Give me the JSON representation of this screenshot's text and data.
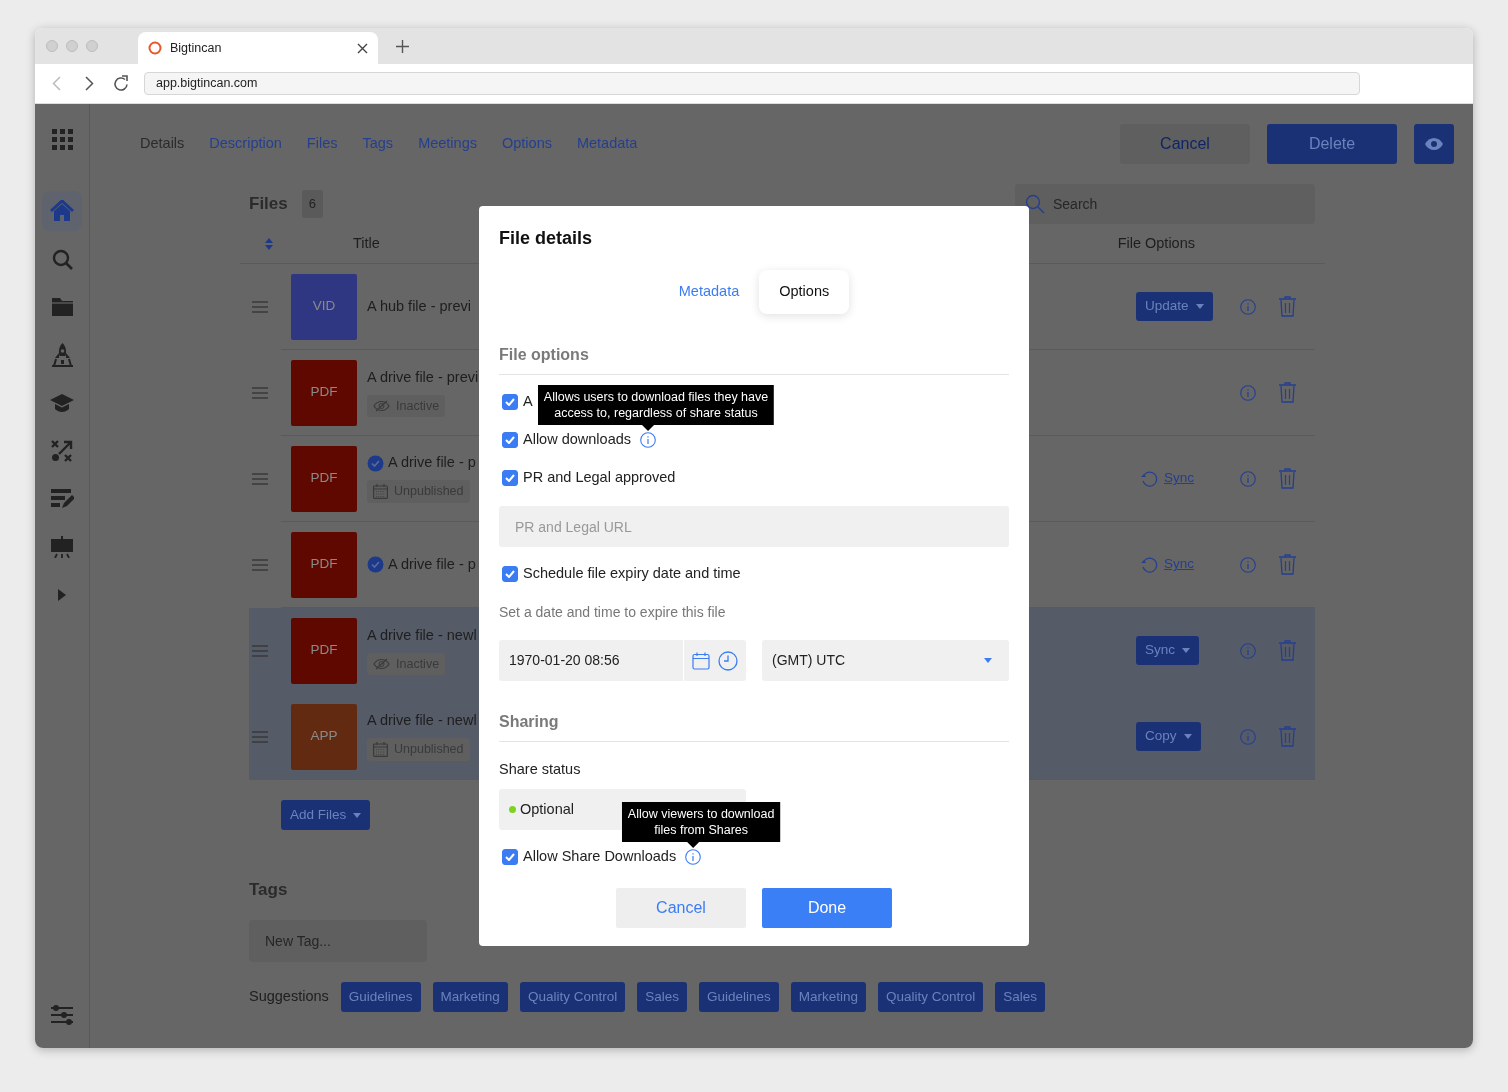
{
  "browser": {
    "tab_title": "Bigtincan",
    "url": "app.bigtincan.com"
  },
  "sidebar": {
    "items": [
      {
        "selected": true
      },
      {
        "selected": false
      },
      {
        "selected": false
      },
      {
        "selected": false
      },
      {
        "selected": false
      },
      {
        "selected": false
      },
      {
        "selected": false
      },
      {
        "selected": false
      }
    ]
  },
  "nav_tabs": [
    {
      "label": "Details",
      "selected": true
    },
    {
      "label": "Description",
      "selected": false
    },
    {
      "label": "Files",
      "selected": false
    },
    {
      "label": "Tags",
      "selected": false
    },
    {
      "label": "Meetings",
      "selected": false
    },
    {
      "label": "Options",
      "selected": false
    },
    {
      "label": "Metadata",
      "selected": false
    }
  ],
  "header_actions": {
    "cancel": "Cancel",
    "delete": "Delete"
  },
  "files": {
    "title": "Files",
    "count": "6",
    "search_placeholder": "Search",
    "columns": [
      "Title",
      "File Options"
    ],
    "rows": [
      {
        "type_label": "VID",
        "color": "#2f3782",
        "title": "A hub file - previ",
        "verified": false,
        "highlighted": false,
        "option": {
          "kind": "dropdown",
          "label": "Update"
        }
      },
      {
        "type_label": "PDF",
        "color": "#5f0800",
        "title": "A drive file - previ",
        "verified": false,
        "highlighted": false,
        "status": {
          "kind": "inactive",
          "label": "Inactive"
        }
      },
      {
        "type_label": "PDF",
        "color": "#5f0800",
        "title": "A drive file - p",
        "verified": true,
        "highlighted": false,
        "status": {
          "kind": "unpublished",
          "label": "Unpublished"
        },
        "option": {
          "kind": "link",
          "label": "Sync"
        }
      },
      {
        "type_label": "PDF",
        "color": "#5f0800",
        "title": "A drive file - p",
        "verified": true,
        "highlighted": false,
        "option": {
          "kind": "link",
          "label": "Sync"
        }
      },
      {
        "type_label": "PDF",
        "color": "#5f0800",
        "title": "A drive file - newl",
        "verified": false,
        "highlighted": true,
        "status": {
          "kind": "inactive",
          "label": "Inactive"
        },
        "option": {
          "kind": "dropdown",
          "label": "Sync"
        }
      },
      {
        "type_label": "APP",
        "color": "#622a10",
        "title": "A drive file - newl",
        "verified": false,
        "highlighted": true,
        "status": {
          "kind": "unpublished",
          "label": "Unpublished"
        },
        "option": {
          "kind": "dropdown",
          "label": "Copy"
        }
      }
    ],
    "add_button": "Add Files"
  },
  "tags": {
    "title": "Tags",
    "placeholder": "New Tag...",
    "suggestions_label": "Suggestions",
    "suggestions": [
      "Guidelines",
      "Marketing",
      "Quality Control",
      "Sales",
      "Guidelines",
      "Marketing",
      "Quality Control",
      "Sales"
    ]
  },
  "modal": {
    "title": "File details",
    "tabs": [
      {
        "label": "Metadata",
        "selected": false
      },
      {
        "label": "Options",
        "selected": true
      }
    ],
    "file_options": {
      "heading": "File options",
      "checks": [
        {
          "label": "A",
          "checked": true
        },
        {
          "label": "Allow downloads",
          "checked": true,
          "tooltip": "Allows users to download files they have\naccess to, regardless of share status"
        },
        {
          "label": "PR and Legal approved",
          "checked": true
        }
      ],
      "url_placeholder": "PR and Legal URL",
      "schedule": {
        "label": "Schedule file expiry date and time",
        "checked": true
      },
      "hint": "Set a date and time to expire this file",
      "date_value": "1970-01-20 08:56",
      "timezone": "(GMT) UTC"
    },
    "sharing": {
      "heading": "Sharing",
      "status_label": "Share status",
      "status": {
        "label": "Optional",
        "color": "#7ed321"
      },
      "share_downloads": {
        "label": "Allow Share Downloads",
        "checked": true,
        "tooltip": "Allow viewers to download\nfiles from Shares"
      }
    },
    "buttons": {
      "cancel": "Cancel",
      "done": "Done"
    }
  }
}
